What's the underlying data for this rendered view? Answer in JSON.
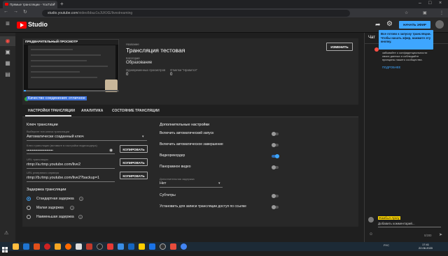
{
  "browser": {
    "tab_title": "Прямые трансляции - YouTube",
    "url_host": "studio.youtube.com",
    "url_path": "/video/bbuz1xJUKXE/livestreaming"
  },
  "header": {
    "logo_text": "Studio",
    "start_button": "НАЧАТЬ ЭФИР"
  },
  "preview": {
    "title": "ПРЕДВАРИТЕЛЬНЫЙ ПРОСМОТР",
    "connection_status": "Качество соединения: отличное"
  },
  "stream": {
    "name_label": "Название",
    "name": "Трансляция тестовая",
    "category_label": "Категория",
    "category": "Образование",
    "viewers_label": "Одновременных просмотров",
    "viewers": "0",
    "likes_label": "Отметки \"Нравится\"",
    "likes": "0",
    "change_button": "ИЗМЕНИТЬ"
  },
  "tabs": [
    {
      "label": "НАСТРОЙКИ ТРАНСЛЯЦИИ"
    },
    {
      "label": "АНАЛИТИКА"
    },
    {
      "label": "СОСТОЯНИЕ ТРАНСЛЯЦИИ"
    }
  ],
  "settings": {
    "key_section": "Ключ трансляции",
    "key_type_label": "Выберите тип ключа трансляции",
    "key_type": "Автоматически созданный ключ",
    "key_label": "Ключ трансляции (вставьте в настройки видеокодера)",
    "key_value": "••••••••••••••••••••••••",
    "copy_label": "КОПИРОВАТЬ",
    "url_label": "URL трансляции",
    "url_value": "rtmp://a.rtmp.youtube.com/live2",
    "backup_label": "URL резервного сервера",
    "backup_value": "rtmp://b.rtmp.youtube.com/live2?backup=1",
    "delay_section": "Задержка трансляции",
    "delay_options": [
      {
        "label": "Стандартная задержка",
        "selected": true
      },
      {
        "label": "Малая задержка",
        "selected": false
      },
      {
        "label": "Наименьшая задержка",
        "selected": false
      }
    ],
    "extra_section": "Дополнительные настройки",
    "toggles": [
      {
        "label": "Включить автоматический запуск",
        "on": false
      },
      {
        "label": "Включить автоматическое завершение",
        "on": false
      },
      {
        "label": "Видеорекордер",
        "on": true
      },
      {
        "label": "Панорамное видео",
        "on": false
      }
    ],
    "delay2_label": "Дополнительная задержка",
    "delay2_value": "Нет",
    "toggles2": [
      {
        "label": "Субтитры",
        "on": false
      },
      {
        "label": "Установить для записи трансляции доступ по ссылке",
        "on": false
      }
    ]
  },
  "chat": {
    "title": "Чат",
    "tooltip": "Все готово к запуску трансляции. Чтобы начать эфир, нажмите эту кнопку.",
    "notice": "забывайте о конфиденциальности своих данных и соблюдайте принципы нашего сообщества.",
    "notice_link": "ПОДРОБНЕЕ",
    "user_name": "Жамбыл-Арзоу",
    "input_placeholder": "Добавить комментарий...",
    "counter": "0/200"
  },
  "taskbar": {
    "lang": "РУС",
    "time": "17:41",
    "date": "22.06.2020"
  },
  "colors": {
    "accent": "#3ea6ff",
    "brand_red": "#ff0000",
    "status_green": "#2ba640"
  }
}
